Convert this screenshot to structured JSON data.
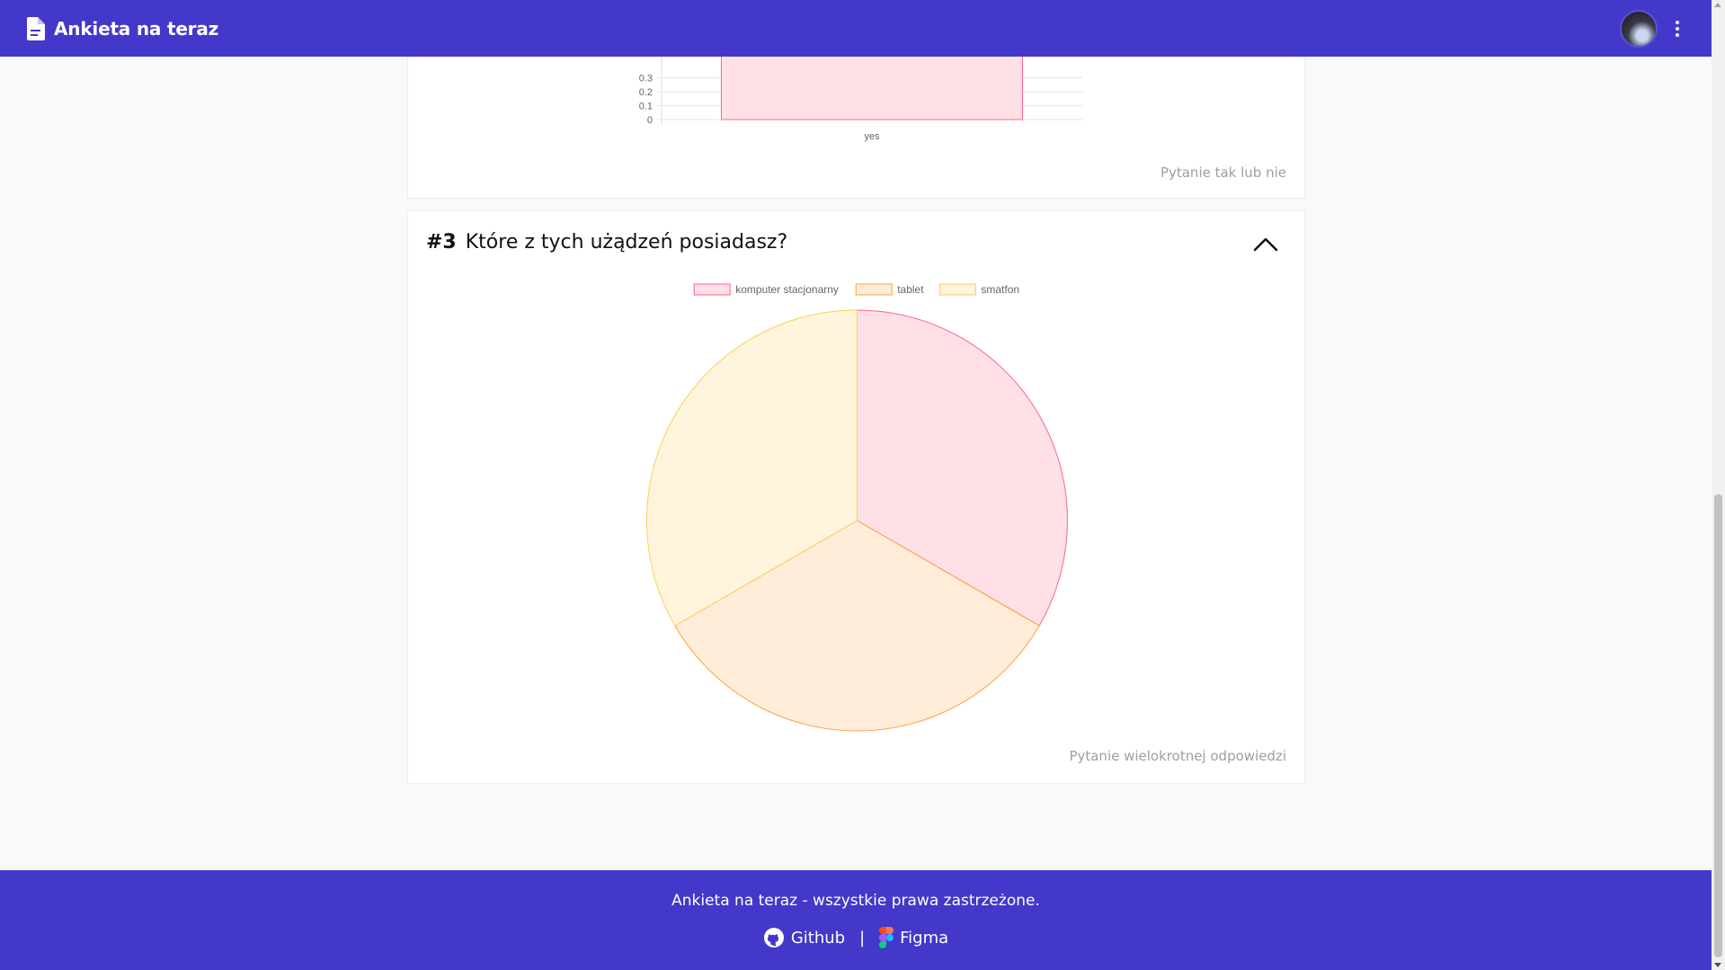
{
  "app": {
    "title": "Ankieta na teraz"
  },
  "card_prev": {
    "type_note": "Pytanie tak lub nie",
    "chart_data": {
      "type": "bar",
      "categories": [
        "yes"
      ],
      "values": [
        1
      ],
      "visible_ticks": [
        "0",
        "0.1",
        "0.2",
        "0.3"
      ],
      "color": "#ffe0e6",
      "border_color": "#ff6384"
    }
  },
  "question3": {
    "number": "#3",
    "text": "Które z tych użądzeń posiadasz?",
    "type_note": "Pytanie wielokrotnej odpowiedzi",
    "chart_data": {
      "type": "pie",
      "labels": [
        "komputer stacjonarny",
        "tablet",
        "smatfon"
      ],
      "values": [
        1,
        1,
        1
      ],
      "colors": [
        "#ffe0e6",
        "#ffecd9",
        "#fff5dd"
      ],
      "border_colors": [
        "#ff6384",
        "#ff9f40",
        "#ffcd56"
      ],
      "legend_position": "top"
    }
  },
  "footer": {
    "copyright": "Ankieta na teraz - wszystkie prawa zastrzeżone.",
    "github_label": "Github",
    "separator": "|",
    "figma_label": "Figma"
  },
  "icons": {
    "brand": "document-icon",
    "menu": "kebab-menu-icon",
    "collapse": "chevron-up-icon",
    "github": "github-icon",
    "figma": "figma-icon"
  }
}
